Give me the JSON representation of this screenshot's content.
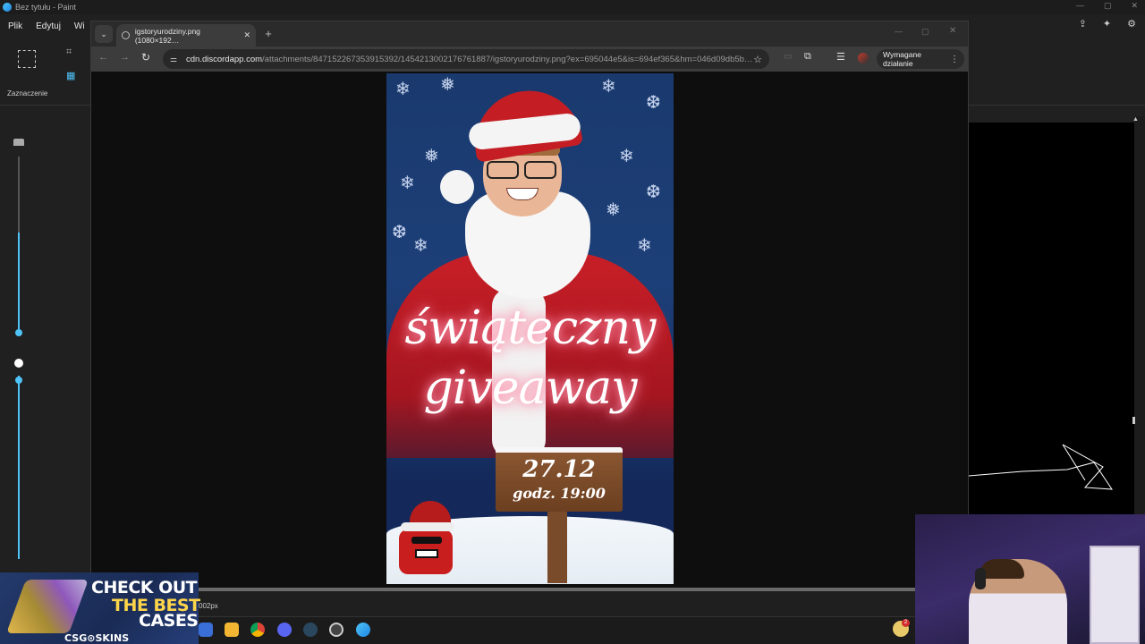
{
  "paint": {
    "title": "Bez tytułu - Paint",
    "menu": [
      "Plik",
      "Edytuj",
      "Wi"
    ],
    "select_label": "Zaznaczenie",
    "status_size": "002px",
    "window_controls": [
      "—",
      "▢",
      "✕"
    ]
  },
  "browser": {
    "tab_title": "igstoryurodziny.png (1080×192…",
    "url_host": "cdn.discordapp.com",
    "url_path": "/attachments/847152267353915392/1454213002176761887/igstoryurodziny.png?ex=695044e5&is=694ef365&hm=046d09db5b…",
    "update_button_label": "Wymagane działanie"
  },
  "poster": {
    "title_line1": "świąteczny",
    "title_line2": "giveaway",
    "date": "27.12",
    "time": "godz. 19:00"
  },
  "ad": {
    "line1": "CHECK OUT",
    "line2": "THE BEST",
    "line3": "CASES",
    "brand": "CSG⊙SKINS"
  },
  "taskbar": {
    "notify_badge": "2",
    "icons": [
      "app-icon",
      "file-explorer-icon",
      "chrome-icon",
      "discord-icon",
      "steam-icon",
      "obs-icon",
      "paint-icon"
    ]
  },
  "colors": {
    "accent": "#4fc3f7",
    "poster_blue": "#1d3f78",
    "santa_red": "#c81f27",
    "ad_yellow": "#ffd54a"
  }
}
